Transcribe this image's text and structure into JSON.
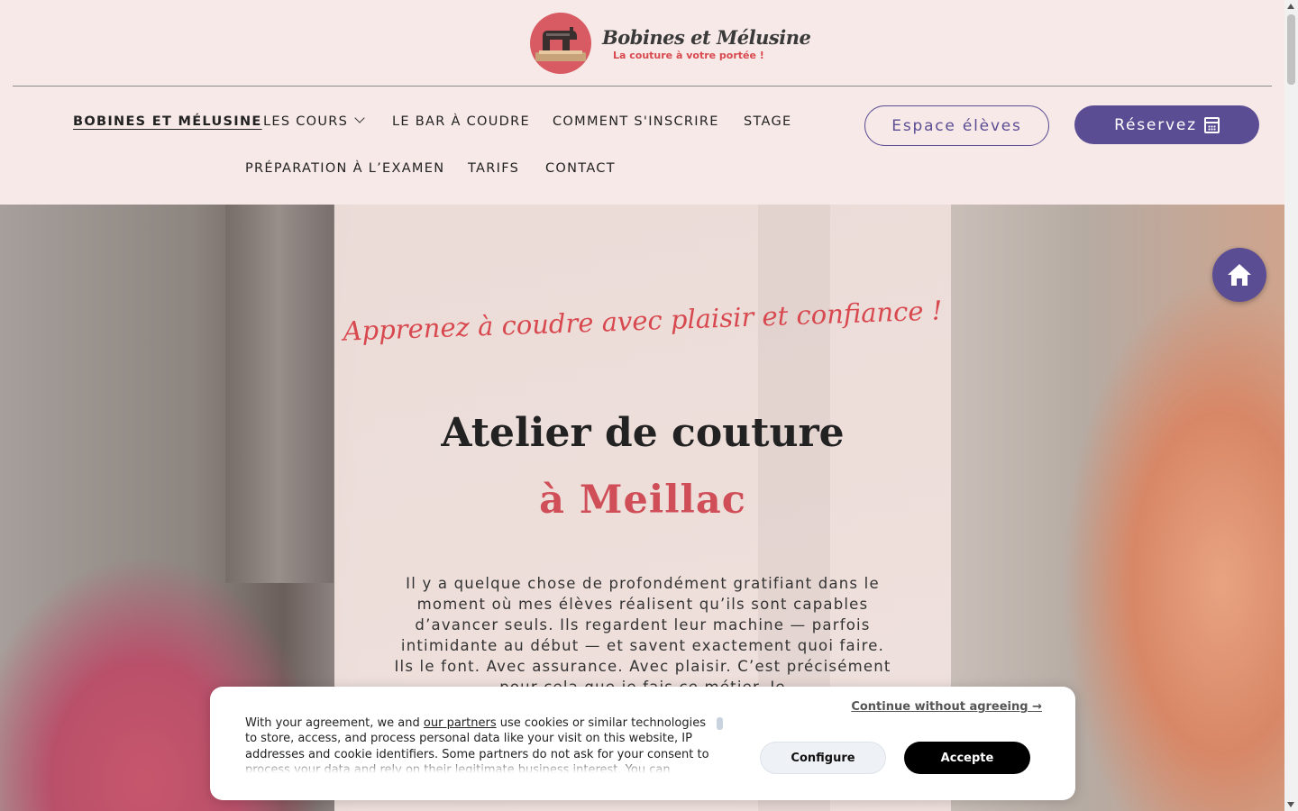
{
  "header": {
    "logo_title": "Bobines et Mélusine",
    "logo_subtitle": "La couture à votre portée !",
    "nav": [
      {
        "label": "BOBINES ET MÉLUSINE",
        "active": true
      },
      {
        "label": "LES COURS",
        "has_dropdown": true
      },
      {
        "label": "LE BAR À COUDRE"
      },
      {
        "label": "COMMENT S'INSCRIRE"
      },
      {
        "label": "STAGE"
      },
      {
        "label": "PRÉPARATION À L’EXAMEN"
      },
      {
        "label": "TARIFS"
      },
      {
        "label": "CONTACT"
      }
    ],
    "student_button": "Espace élèves",
    "book_button": "Réservez",
    "book_icon": "calendar-icon"
  },
  "hero": {
    "tagline": "Apprenez à coudre avec plaisir et confiance !",
    "title": "Atelier de couture",
    "subtitle": "à Meillac",
    "body": "Il y a quelque chose de profondément gratifiant dans le moment où mes élèves réalisent qu’ils sont capables d’avancer seuls. Ils regardent leur machine — parfois intimidante au début — et savent exactement quoi faire. Ils le font. Avec assurance. Avec plaisir. C’est précisément pour cela que je fais ce métier. Je"
  },
  "home_button_icon": "home-icon",
  "cookie_banner": {
    "text_before_link": "With your agreement, we and ",
    "link": "our partners",
    "text_after_link": " use cookies or similar technologies to store, access, and process personal data like your visit on this website, IP addresses and cookie identifiers. Some partners do not ask for your consent to process your data and rely on their legitimate business interest. You can",
    "continue": "Continue without agreeing →",
    "configure": "Configure",
    "accept": "Accepte"
  },
  "colors": {
    "background": "#f7e9e7",
    "accent_purple": "#5b4d94",
    "accent_red": "#d8494f"
  }
}
